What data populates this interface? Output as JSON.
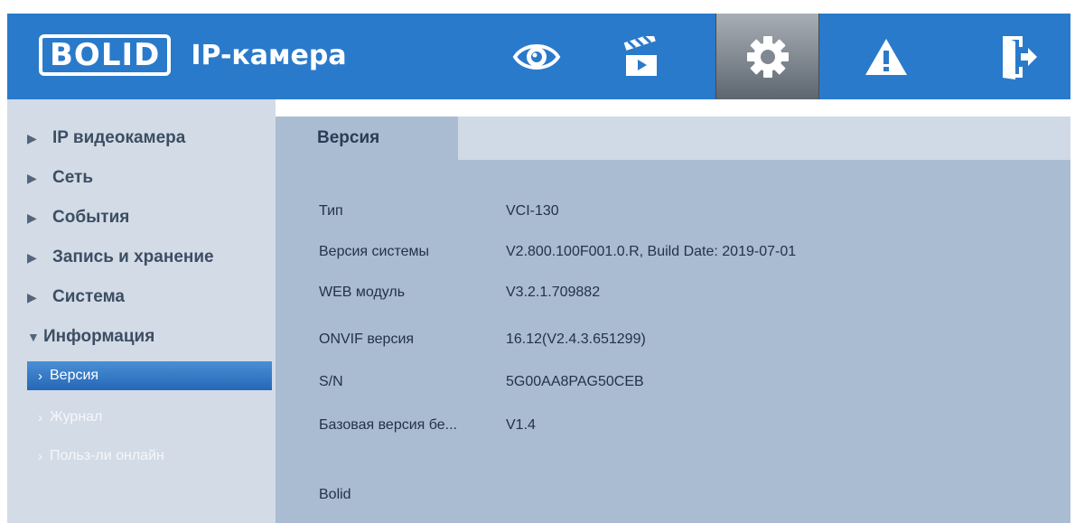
{
  "header": {
    "brand": "BOLID",
    "product": "IP-камера",
    "nav": [
      {
        "icon": "eye-icon"
      },
      {
        "icon": "clapperboard-icon"
      },
      {
        "icon": "gear-icon",
        "active": true
      },
      {
        "icon": "warning-icon"
      },
      {
        "icon": "exit-icon"
      }
    ]
  },
  "sidebar": {
    "items": [
      {
        "label": "IP видеокамера",
        "expanded": false
      },
      {
        "label": "Сеть",
        "expanded": false
      },
      {
        "label": "События",
        "expanded": false
      },
      {
        "label": "Запись и хранение",
        "expanded": false
      },
      {
        "label": "Система",
        "expanded": false
      },
      {
        "label": "Информация",
        "expanded": true
      }
    ],
    "subitems": [
      {
        "label": "Версия",
        "active": true
      },
      {
        "label": "Журнал",
        "active": false
      },
      {
        "label": "Польз-ли онлайн",
        "active": false
      }
    ]
  },
  "main": {
    "tab": "Версия",
    "rows": [
      {
        "label": "Тип",
        "value": "VCI-130"
      },
      {
        "label": "Версия системы",
        "value": "V2.800.100F001.0.R, Build Date: 2019-07-01"
      },
      {
        "label": "WEB модуль",
        "value": "V3.2.1.709882"
      },
      {
        "label": "ONVIF версия",
        "value": "16.12(V2.4.3.651299)"
      },
      {
        "label": "S/N",
        "value": "5G00AA8PAG50CEB"
      },
      {
        "label": "Базовая версия бе...",
        "value": "V1.4"
      }
    ],
    "footer": "Bolid"
  },
  "colors": {
    "header_bg": "#2a7acb",
    "sidebar_bg": "#d3dbe6",
    "content_bg": "#aabcd2",
    "active_item": "#2f74c4"
  }
}
